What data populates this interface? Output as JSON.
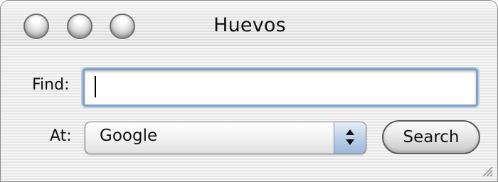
{
  "window": {
    "title": "Huevos"
  },
  "form": {
    "find_label": "Find:",
    "find_value": "",
    "at_label": "At:",
    "at_selected": "Google",
    "search_button_label": "Search"
  },
  "icons": {
    "close": "close-icon",
    "minimize": "minimize-icon",
    "zoom": "zoom-icon",
    "popup_arrows": "updown-arrows-icon",
    "resize": "resize-grip-icon"
  },
  "colors": {
    "focus_ring": "#7fa0c6",
    "popup_arrow_bg": "#b9cde6",
    "text": "#111111"
  }
}
